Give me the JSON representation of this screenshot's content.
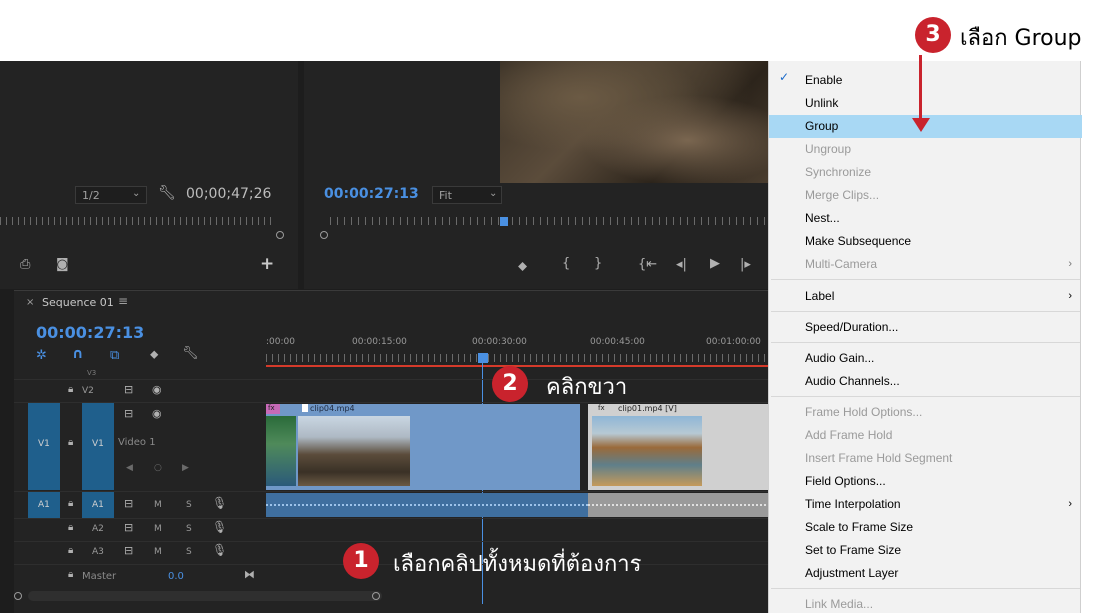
{
  "source_monitor": {
    "zoom": "1/2",
    "timecode": "00;00;47;26"
  },
  "program_monitor": {
    "timecode": "00:00:27:13",
    "fit": "Fit"
  },
  "sequence": {
    "tab": "Sequence 01",
    "timecode": "00:00:27:13",
    "ruler_labels": [
      ":00:00",
      "00:00:15:00",
      "00:00:30:00",
      "00:00:45:00",
      "00:01:00:00"
    ],
    "tracks": {
      "v2": "V2",
      "v1_src": "V1",
      "v1": "V1",
      "v1_name": "Video 1",
      "a1_src": "A1",
      "a1": "A1",
      "a2": "A2",
      "a3": "A3",
      "master": "Master",
      "master_value": "0.0",
      "m": "M",
      "s": "S"
    },
    "clips": {
      "clip04": "clip04.mp4",
      "clip01": "clip01.mp4 [V]",
      "fx": "fx"
    }
  },
  "context_menu": {
    "items": [
      {
        "label": "Enable",
        "checked": true,
        "disabled": false
      },
      {
        "label": "Unlink",
        "disabled": false
      },
      {
        "label": "Group",
        "disabled": false,
        "highlighted": true
      },
      {
        "label": "Ungroup",
        "disabled": true
      },
      {
        "label": "Synchronize",
        "disabled": true
      },
      {
        "label": "Merge Clips...",
        "disabled": true
      },
      {
        "label": "Nest...",
        "disabled": false
      },
      {
        "label": "Make Subsequence",
        "disabled": false
      },
      {
        "label": "Multi-Camera",
        "disabled": true,
        "submenu": true
      },
      {
        "label": "Label",
        "disabled": false,
        "submenu": true
      },
      {
        "label": "Speed/Duration...",
        "disabled": false
      },
      {
        "label": "Audio Gain...",
        "disabled": false
      },
      {
        "label": "Audio Channels...",
        "disabled": false
      },
      {
        "label": "Frame Hold Options...",
        "disabled": true
      },
      {
        "label": "Add Frame Hold",
        "disabled": true
      },
      {
        "label": "Insert Frame Hold Segment",
        "disabled": true
      },
      {
        "label": "Field Options...",
        "disabled": false
      },
      {
        "label": "Time Interpolation",
        "disabled": false,
        "submenu": true
      },
      {
        "label": "Scale to Frame Size",
        "disabled": false
      },
      {
        "label": "Set to Frame Size",
        "disabled": false
      },
      {
        "label": "Adjustment Layer",
        "disabled": false
      },
      {
        "label": "Link Media...",
        "disabled": true
      }
    ]
  },
  "annotations": {
    "step1": {
      "number": "1",
      "text": "เลือกคลิปทั้งหมดที่ต้องการ"
    },
    "step2": {
      "number": "2",
      "text": "คลิกขวา"
    },
    "step3": {
      "number": "3",
      "text": "เลือก Group"
    }
  },
  "colors": {
    "badge": "#c9232d",
    "timecode_blue": "#4a90e2",
    "menu_highlight": "#a8d8f4",
    "track_blue": "#1f5f8c"
  }
}
